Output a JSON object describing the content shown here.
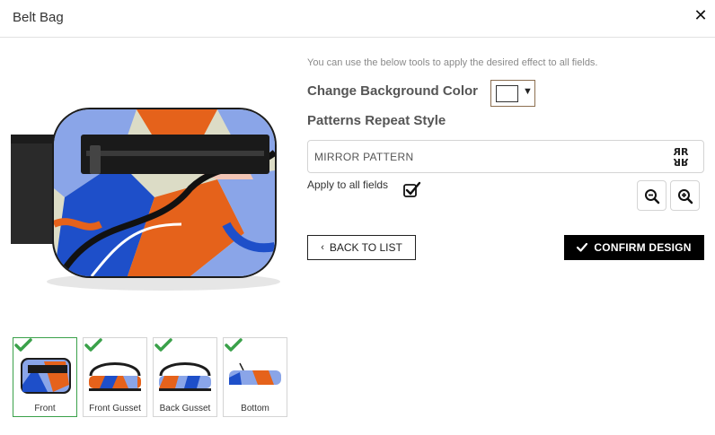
{
  "dialog": {
    "title": "Belt Bag",
    "close_icon": "close-icon"
  },
  "panels": [
    {
      "label": "Front",
      "completed": true,
      "active": true
    },
    {
      "label": "Front Gusset",
      "completed": true,
      "active": false
    },
    {
      "label": "Back Gusset",
      "completed": true,
      "active": false
    },
    {
      "label": "Bottom",
      "completed": true,
      "active": false
    }
  ],
  "tools": {
    "hint": "You can use the below tools to apply the desired effect to all fields.",
    "background_label": "Change Background Color",
    "background_color": "#ffffff",
    "pattern_label": "Patterns Repeat Style",
    "pattern_value": "MIRROR PATTERN",
    "pattern_icon": "mirror-pattern-icon",
    "apply_label": "Apply to all fields",
    "apply_checked": true,
    "zoom_out_icon": "zoom-out-icon",
    "zoom_in_icon": "zoom-in-icon"
  },
  "actions": {
    "back_label": "BACK TO LIST",
    "confirm_label": "CONFIRM DESIGN"
  },
  "colors": {
    "accent_check": "#3aa14a",
    "print_orange": "#e5621b",
    "print_blue": "#1e4fc9",
    "print_periwinkle": "#8aa5e8",
    "print_cream": "#dcdcc6",
    "confirm_bg": "#000000"
  }
}
